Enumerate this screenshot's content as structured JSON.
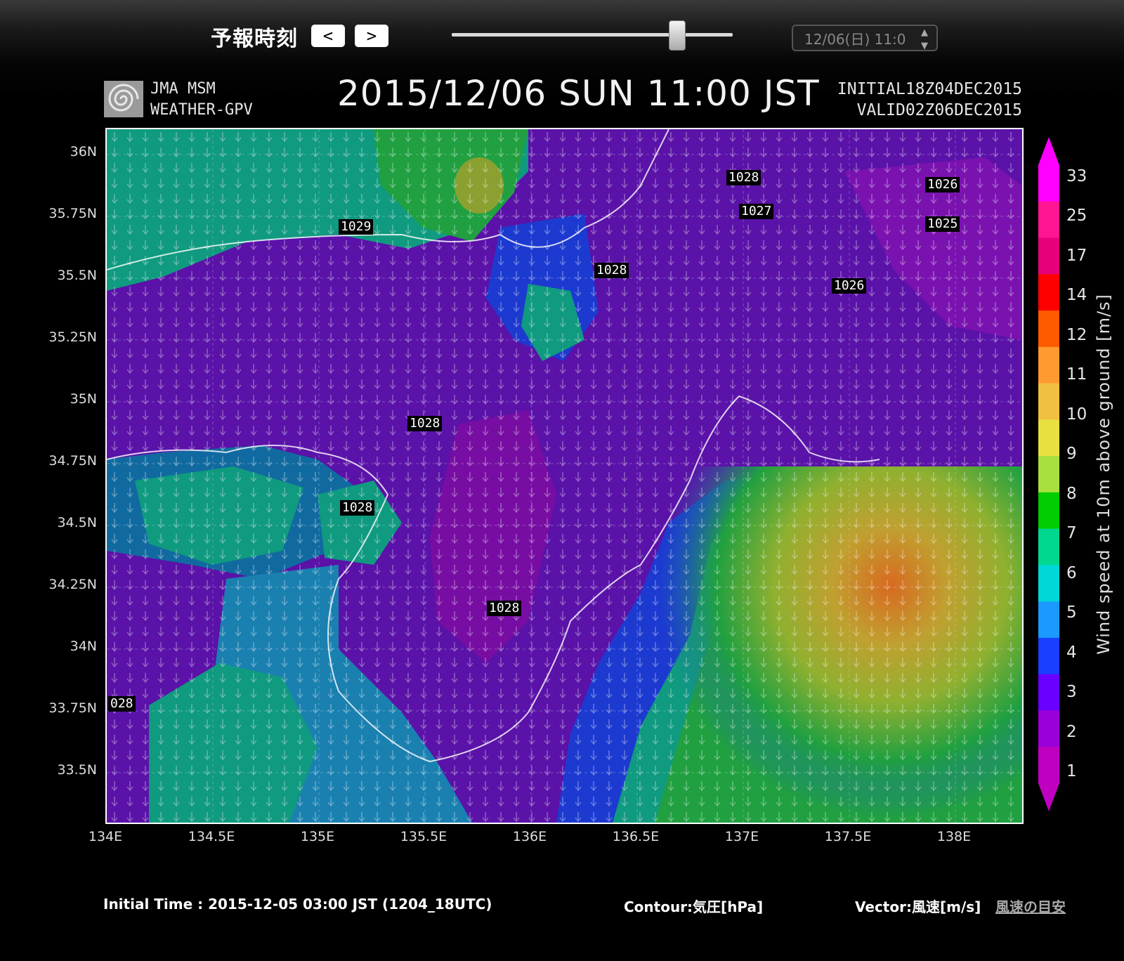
{
  "controls": {
    "label": "予報時刻",
    "prev_label": "<",
    "next_label": ">",
    "slider_position": 0.8,
    "time_select_value": "12/06(日) 11:0"
  },
  "header": {
    "logo_line1": "JMA MSM",
    "logo_line2": "WEATHER-GPV",
    "title": "2015/12/06 SUN 11:00 JST",
    "initial": "INITIAL18Z04DEC2015",
    "valid": "VALID02Z06DEC2015"
  },
  "map": {
    "lat_labels": [
      "36N",
      "35.75N",
      "35.5N",
      "35.25N",
      "35N",
      "34.75N",
      "34.5N",
      "34.25N",
      "34N",
      "33.75N",
      "33.5N"
    ],
    "lon_labels": [
      "134E",
      "134.5E",
      "135E",
      "135.5E",
      "136E",
      "136.5E",
      "137E",
      "137.5E",
      "138E"
    ],
    "isobar_labels": [
      "1028",
      "1027",
      "1026",
      "1025",
      "1029",
      "1028",
      "1026",
      "1028",
      "1028",
      "1028",
      "028"
    ]
  },
  "colorbar": {
    "labels": [
      "33",
      "25",
      "17",
      "14",
      "12",
      "11",
      "10",
      "9",
      "8",
      "7",
      "6",
      "5",
      "4",
      "3",
      "2",
      "1"
    ],
    "colors": [
      "#ff00ff",
      "#ff1493",
      "#e6007a",
      "#ff0000",
      "#ff5a00",
      "#ff9a30",
      "#f2c040",
      "#e8e040",
      "#a8e040",
      "#00cc00",
      "#00d890",
      "#00d8d8",
      "#1a9aff",
      "#1a40ff",
      "#6a00ff",
      "#9a00d8",
      "#c000c0"
    ],
    "title": "Wind speed at 10m above ground [m/s]"
  },
  "footer": {
    "initial_time": "Initial Time : 2015-12-05 03:00 JST (1204_18UTC)",
    "contour": "Contour:気圧[hPa]",
    "vector": "Vector:風速[m/s]",
    "wind_guide": "風速の目安"
  }
}
